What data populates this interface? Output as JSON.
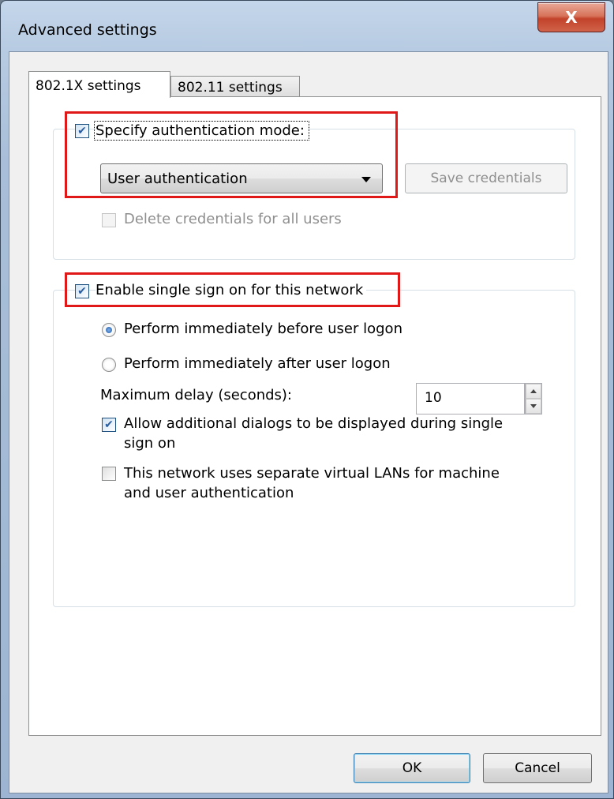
{
  "window": {
    "title": "Advanced settings",
    "close_label": "X"
  },
  "tabs": [
    {
      "label": "802.1X settings",
      "active": true
    },
    {
      "label": "802.11 settings",
      "active": false
    }
  ],
  "auth": {
    "specify_mode_label": "Specify authentication mode:",
    "specify_mode_checked": true,
    "mode_selected": "User authentication",
    "save_credentials_label": "Save credentials",
    "delete_credentials_label": "Delete credentials for all users",
    "delete_credentials_checked": false
  },
  "sso": {
    "enable_label": "Enable single sign on for this network",
    "enable_checked": true,
    "before_logon_label": "Perform immediately before user logon",
    "before_logon_selected": true,
    "after_logon_label": "Perform immediately after user logon",
    "after_logon_selected": false,
    "max_delay_label": "Maximum delay (seconds):",
    "max_delay_value": "10",
    "allow_dialogs_label_1": "Allow additional dialogs to be displayed during single",
    "allow_dialogs_label_2": "sign on",
    "allow_dialogs_checked": true,
    "vlan_label_1": "This network uses separate virtual LANs for machine",
    "vlan_label_2": "and user authentication",
    "vlan_checked": false
  },
  "buttons": {
    "ok_label": "OK",
    "cancel_label": "Cancel"
  },
  "colors": {
    "highlight": "#e01818",
    "close_button": "#c2432a",
    "accent": "#2a5ea0"
  }
}
